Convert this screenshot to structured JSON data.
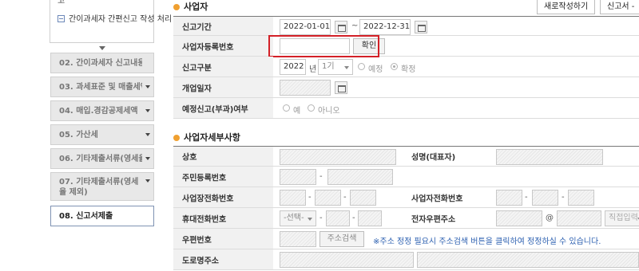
{
  "sidebar": {
    "cut_item_tail": "고",
    "sub_item_label": "간이과세자 간편신고 작성 처리",
    "items": [
      {
        "label": "02. 간이과세자 신고내용"
      },
      {
        "label": "03. 과세표준 및 매출세액"
      },
      {
        "label": "04. 매입.경감공제세액"
      },
      {
        "label": "05. 가산세"
      },
      {
        "label": "06. 기타제출서류(영세율"
      },
      {
        "label": "07. 기타제출서류(영세율 제외)"
      },
      {
        "label": "08. 신고서제출"
      }
    ]
  },
  "header": {
    "section_title": "사업자",
    "new_button": "새로작성하기",
    "report_button": "신고서 -"
  },
  "business": {
    "period_label": "신고기간",
    "period_start": "2022-01-01",
    "period_tilde": "~",
    "period_end": "2022-12-31",
    "reg_no_label": "사업자등록번호",
    "reg_no_value": "",
    "confirm_button": "확인",
    "report_type_label": "신고구분",
    "year": "2022",
    "year_unit": "년",
    "term_selected": "1기",
    "radio_planned": "예정",
    "radio_final": "확정",
    "open_date_label": "개업일자",
    "planned_tax_label": "예정신고(부과)여부",
    "radio_yes": "예",
    "radio_no": "아니오"
  },
  "detail": {
    "section_title": "사업자세부사항",
    "trade_name_label": "상호",
    "ceo_name_label": "성명(대표자)",
    "resident_no_label": "주민등록번호",
    "dash": "-",
    "biz_phone_label": "사업장전화번호",
    "biz_contact_label": "사업자전화번호",
    "mobile_label": "휴대전화번호",
    "mobile_select": "-선택-",
    "email_label": "전자우편주소",
    "at_sign": "@",
    "email_domain_select": "직접입력",
    "zip_label": "우편번호",
    "address_search_button": "주소검색",
    "address_hint": "※주소 정정 필요시 주소검색 버튼을 클릭하여 정정하실 수 있습니다.",
    "road_address_label": "도로명주소"
  },
  "colors": {
    "accent_bullet": "#f0a030",
    "highlight_box": "#d32027",
    "hint_text": "#2b5fb0"
  }
}
